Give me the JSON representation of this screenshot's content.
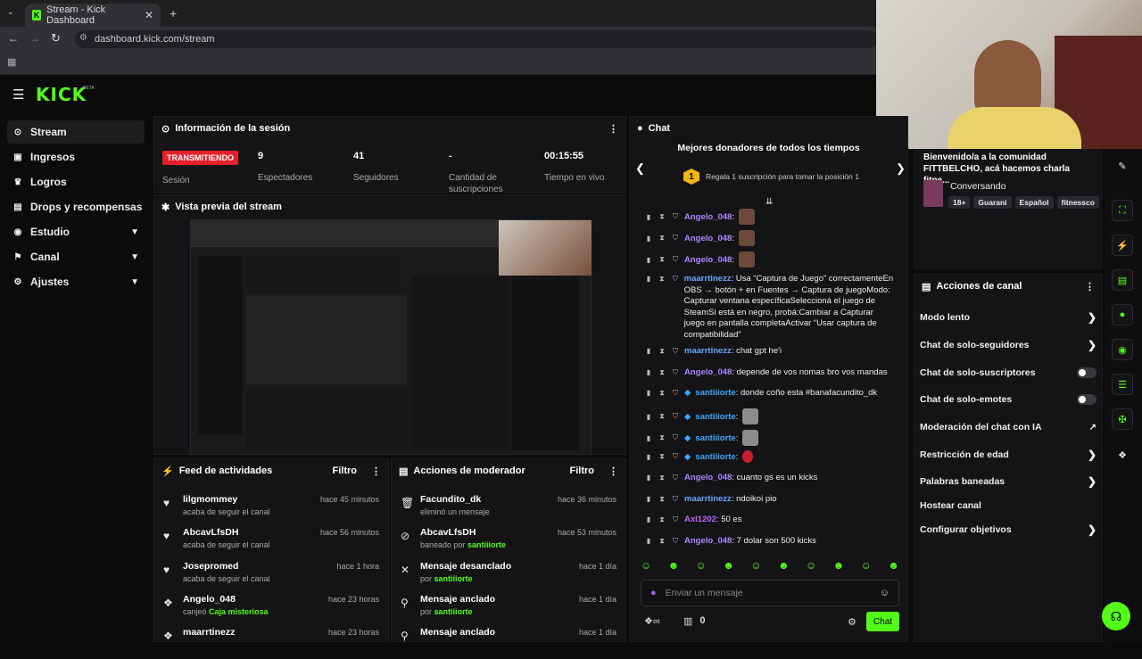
{
  "browser": {
    "tab_title": "Stream - Kick Dashboard",
    "url": "dashboard.kick.com/stream"
  },
  "brand": {
    "logo": "KICK",
    "beta": "BETA",
    "accent": "#53fc18"
  },
  "sidebar": {
    "items": [
      {
        "label": "Stream",
        "icon": "broadcast-icon",
        "active": true
      },
      {
        "label": "Ingresos",
        "icon": "wallet-icon"
      },
      {
        "label": "Logros",
        "icon": "trophy-icon"
      },
      {
        "label": "Drops y recompensas",
        "icon": "gift-icon"
      },
      {
        "label": "Estudio",
        "icon": "studio-icon"
      },
      {
        "label": "Canal",
        "icon": "channel-icon"
      },
      {
        "label": "Ajustes",
        "icon": "gear-icon"
      }
    ]
  },
  "session": {
    "title": "Información de la sesión",
    "status": "TRANSMITIENDO",
    "status_label": "Sesión",
    "stats": [
      {
        "value": "9",
        "label": "Espectadores"
      },
      {
        "value": "41",
        "label": "Seguidores"
      },
      {
        "value": "-",
        "label": "Cantidad de suscripciones"
      },
      {
        "value": "00:15:55",
        "label": "Tiempo en vivo"
      }
    ]
  },
  "preview": {
    "title": "Vista previa del stream"
  },
  "feed": {
    "title": "Feed de actividades",
    "filter": "Filtro",
    "items": [
      {
        "name": "lilgmommey",
        "sub": "acaba de seguir el canal",
        "time": "hace 45 minutos",
        "icon": "heart-icon"
      },
      {
        "name": "AbcavLfsDH",
        "sub": "acaba de seguir el canal",
        "time": "hace 56 minutos",
        "icon": "heart-icon"
      },
      {
        "name": "Josepromed",
        "sub": "acaba de seguir el canal",
        "time": "hace 1 hora",
        "icon": "heart-icon"
      },
      {
        "name": "Angelo_048",
        "sub_pre": "canjeó ",
        "sub_hl": "Caja misteriosa",
        "time": "hace 23 horas",
        "icon": "points-icon"
      },
      {
        "name": "maarrtinezz",
        "time": "hace 23 horas",
        "icon": "points-icon"
      }
    ]
  },
  "mod": {
    "title": "Acciones de moderador",
    "filter": "Filtro",
    "items": [
      {
        "name": "Facundito_dk",
        "sub": "eliminó un mensaje",
        "time": "hace 36 minutos",
        "icon": "trash-icon"
      },
      {
        "name": "AbcavLfsDH",
        "sub_pre": "baneado por ",
        "sub_hl": "santiiiorte",
        "time": "hace 53 minutos",
        "icon": "ban-icon"
      },
      {
        "name": "Mensaje desanclado",
        "sub_pre": "por ",
        "sub_hl": "santiiiorte",
        "time": "hace 1 día",
        "icon": "unpin-icon"
      },
      {
        "name": "Mensaje anclado",
        "sub_pre": "por ",
        "sub_hl": "santiiiorte",
        "time": "hace 1 día",
        "icon": "pin-icon"
      },
      {
        "name": "Mensaje anclado",
        "time": "hace 1 día",
        "icon": "pin-icon"
      }
    ]
  },
  "chat": {
    "title": "Chat",
    "donors_title": "Mejores donadores de todos los tiempos",
    "donors_cta": "Regala 1 suscripción para tomar la posición 1",
    "rank": "1",
    "messages": [
      {
        "user": "Angelo_048",
        "text": ":",
        "emote": true,
        "style": "u1"
      },
      {
        "user": "Angelo_048",
        "text": ":",
        "emote": true,
        "style": "u1"
      },
      {
        "user": "Angelo_048",
        "text": ":",
        "emote": true,
        "style": "u1"
      },
      {
        "user": "maarrtinezz",
        "text": ": Usa “Captura de Juego” correctamenteEn OBS → botón + en Fuentes → Captura de juegoModo: Capturar ventana específicaSeleccioná el juego de SteamSi está en negro, probá:Cambiar a Capturar juego en pantalla completaActivar “Usar captura de compatibilidad”",
        "style": "u4"
      },
      {
        "user": "maarrtinezz",
        "text": ": chat gpt he'i",
        "style": "u4"
      },
      {
        "user": "Angelo_048",
        "text": ": depende de vos nomas bro vos mandas",
        "style": "u1"
      },
      {
        "user": "santiiiorte",
        "text": ": donde coño esta #banafacundito_dk",
        "style": "u2"
      },
      {
        "user": "santiiiorte",
        "text": ":",
        "emote": true,
        "style": "u2"
      },
      {
        "user": "santiiiorte",
        "text": ":",
        "emote": true,
        "style": "u2"
      },
      {
        "user": "santiiiorte",
        "text": ":",
        "emote": true,
        "style": "u2"
      },
      {
        "user": "Angelo_048",
        "text": ": cuanto gs es un kicks",
        "style": "u1"
      },
      {
        "user": "maarrtinezz",
        "text": ": ndoikoi pio",
        "style": "u4"
      },
      {
        "user": "Axl1202",
        "text": ": 50 es",
        "style": "u3"
      },
      {
        "user": "Angelo_048",
        "text": ": 7 dolar son 500 kicks",
        "style": "u1"
      }
    ],
    "input_placeholder": "Enviar un mensaje",
    "points": "0",
    "send": "Chat"
  },
  "channel": {
    "welcome": "Bienvenido/a a la comunidad FITTBELCHO, acá hacemos charla fitne...",
    "category": "Conversando",
    "tags": [
      "18+",
      "Guarani",
      "Español",
      "fitnessco"
    ]
  },
  "actions": {
    "title": "Acciones de canal",
    "items": [
      {
        "label": "Modo lento",
        "control": "chevron"
      },
      {
        "label": "Chat de solo-seguidores",
        "control": "chevron"
      },
      {
        "label": "Chat de solo-suscriptores",
        "control": "toggle"
      },
      {
        "label": "Chat de solo-emotes",
        "control": "toggle"
      },
      {
        "label": "Moderación del chat con IA",
        "control": "external"
      },
      {
        "label": "Restricción de edad",
        "control": "chevron"
      },
      {
        "label": "Palabras baneadas",
        "control": "chevron"
      },
      {
        "label": "Hostear canal",
        "control": "none"
      },
      {
        "label": "Configurar objetivos",
        "control": "chevron"
      }
    ]
  }
}
